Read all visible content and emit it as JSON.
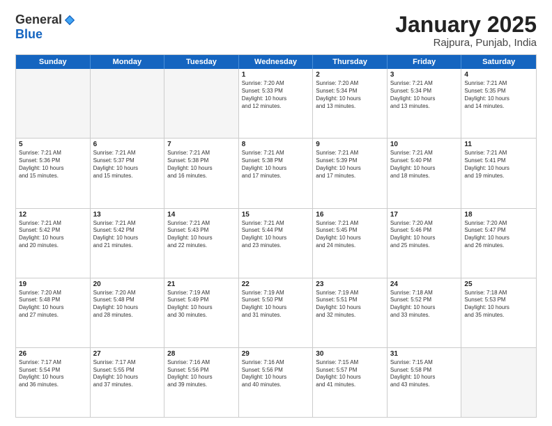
{
  "header": {
    "logo_general": "General",
    "logo_blue": "Blue",
    "title": "January 2025",
    "location": "Rajpura, Punjab, India"
  },
  "weekdays": [
    "Sunday",
    "Monday",
    "Tuesday",
    "Wednesday",
    "Thursday",
    "Friday",
    "Saturday"
  ],
  "rows": [
    [
      {
        "day": "",
        "text": "",
        "empty": true
      },
      {
        "day": "",
        "text": "",
        "empty": true
      },
      {
        "day": "",
        "text": "",
        "empty": true
      },
      {
        "day": "1",
        "text": "Sunrise: 7:20 AM\nSunset: 5:33 PM\nDaylight: 10 hours\nand 12 minutes."
      },
      {
        "day": "2",
        "text": "Sunrise: 7:20 AM\nSunset: 5:34 PM\nDaylight: 10 hours\nand 13 minutes."
      },
      {
        "day": "3",
        "text": "Sunrise: 7:21 AM\nSunset: 5:34 PM\nDaylight: 10 hours\nand 13 minutes."
      },
      {
        "day": "4",
        "text": "Sunrise: 7:21 AM\nSunset: 5:35 PM\nDaylight: 10 hours\nand 14 minutes."
      }
    ],
    [
      {
        "day": "5",
        "text": "Sunrise: 7:21 AM\nSunset: 5:36 PM\nDaylight: 10 hours\nand 15 minutes."
      },
      {
        "day": "6",
        "text": "Sunrise: 7:21 AM\nSunset: 5:37 PM\nDaylight: 10 hours\nand 15 minutes."
      },
      {
        "day": "7",
        "text": "Sunrise: 7:21 AM\nSunset: 5:38 PM\nDaylight: 10 hours\nand 16 minutes."
      },
      {
        "day": "8",
        "text": "Sunrise: 7:21 AM\nSunset: 5:38 PM\nDaylight: 10 hours\nand 17 minutes."
      },
      {
        "day": "9",
        "text": "Sunrise: 7:21 AM\nSunset: 5:39 PM\nDaylight: 10 hours\nand 17 minutes."
      },
      {
        "day": "10",
        "text": "Sunrise: 7:21 AM\nSunset: 5:40 PM\nDaylight: 10 hours\nand 18 minutes."
      },
      {
        "day": "11",
        "text": "Sunrise: 7:21 AM\nSunset: 5:41 PM\nDaylight: 10 hours\nand 19 minutes."
      }
    ],
    [
      {
        "day": "12",
        "text": "Sunrise: 7:21 AM\nSunset: 5:42 PM\nDaylight: 10 hours\nand 20 minutes."
      },
      {
        "day": "13",
        "text": "Sunrise: 7:21 AM\nSunset: 5:42 PM\nDaylight: 10 hours\nand 21 minutes."
      },
      {
        "day": "14",
        "text": "Sunrise: 7:21 AM\nSunset: 5:43 PM\nDaylight: 10 hours\nand 22 minutes."
      },
      {
        "day": "15",
        "text": "Sunrise: 7:21 AM\nSunset: 5:44 PM\nDaylight: 10 hours\nand 23 minutes."
      },
      {
        "day": "16",
        "text": "Sunrise: 7:21 AM\nSunset: 5:45 PM\nDaylight: 10 hours\nand 24 minutes."
      },
      {
        "day": "17",
        "text": "Sunrise: 7:20 AM\nSunset: 5:46 PM\nDaylight: 10 hours\nand 25 minutes."
      },
      {
        "day": "18",
        "text": "Sunrise: 7:20 AM\nSunset: 5:47 PM\nDaylight: 10 hours\nand 26 minutes."
      }
    ],
    [
      {
        "day": "19",
        "text": "Sunrise: 7:20 AM\nSunset: 5:48 PM\nDaylight: 10 hours\nand 27 minutes."
      },
      {
        "day": "20",
        "text": "Sunrise: 7:20 AM\nSunset: 5:48 PM\nDaylight: 10 hours\nand 28 minutes."
      },
      {
        "day": "21",
        "text": "Sunrise: 7:19 AM\nSunset: 5:49 PM\nDaylight: 10 hours\nand 30 minutes."
      },
      {
        "day": "22",
        "text": "Sunrise: 7:19 AM\nSunset: 5:50 PM\nDaylight: 10 hours\nand 31 minutes."
      },
      {
        "day": "23",
        "text": "Sunrise: 7:19 AM\nSunset: 5:51 PM\nDaylight: 10 hours\nand 32 minutes."
      },
      {
        "day": "24",
        "text": "Sunrise: 7:18 AM\nSunset: 5:52 PM\nDaylight: 10 hours\nand 33 minutes."
      },
      {
        "day": "25",
        "text": "Sunrise: 7:18 AM\nSunset: 5:53 PM\nDaylight: 10 hours\nand 35 minutes."
      }
    ],
    [
      {
        "day": "26",
        "text": "Sunrise: 7:17 AM\nSunset: 5:54 PM\nDaylight: 10 hours\nand 36 minutes."
      },
      {
        "day": "27",
        "text": "Sunrise: 7:17 AM\nSunset: 5:55 PM\nDaylight: 10 hours\nand 37 minutes."
      },
      {
        "day": "28",
        "text": "Sunrise: 7:16 AM\nSunset: 5:56 PM\nDaylight: 10 hours\nand 39 minutes."
      },
      {
        "day": "29",
        "text": "Sunrise: 7:16 AM\nSunset: 5:56 PM\nDaylight: 10 hours\nand 40 minutes."
      },
      {
        "day": "30",
        "text": "Sunrise: 7:15 AM\nSunset: 5:57 PM\nDaylight: 10 hours\nand 41 minutes."
      },
      {
        "day": "31",
        "text": "Sunrise: 7:15 AM\nSunset: 5:58 PM\nDaylight: 10 hours\nand 43 minutes."
      },
      {
        "day": "",
        "text": "",
        "empty": true
      }
    ]
  ]
}
